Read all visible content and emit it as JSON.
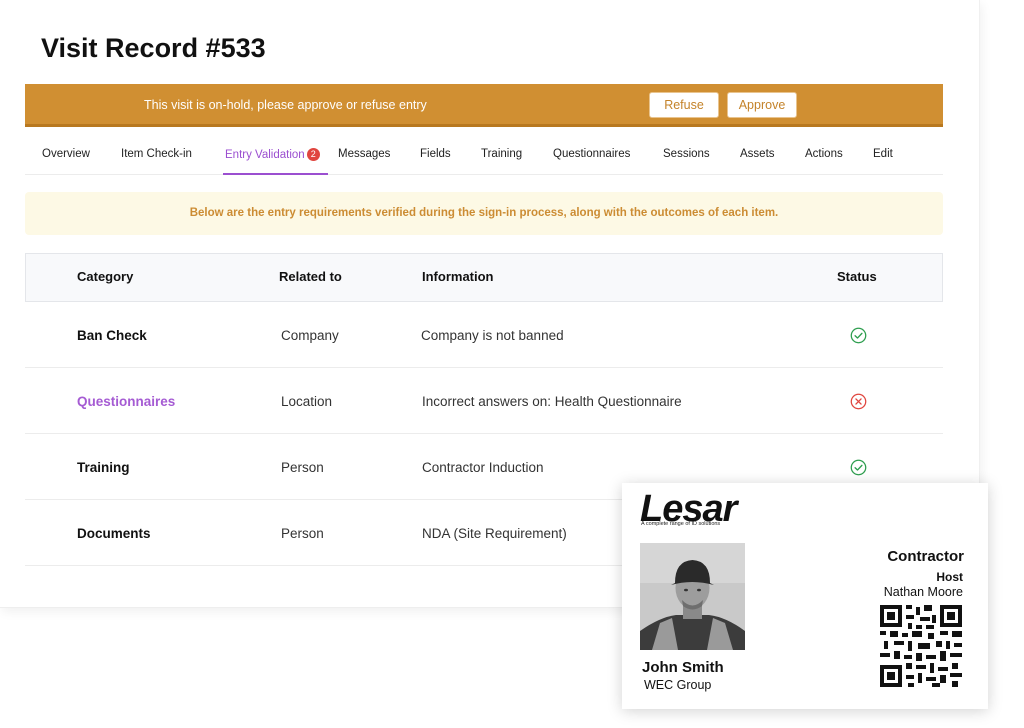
{
  "page": {
    "title": "Visit Record #533"
  },
  "banner": {
    "message": "This visit is on-hold, please approve or refuse entry",
    "refuse_label": "Refuse",
    "approve_label": "Approve",
    "color": "#d08f32"
  },
  "tabs": [
    {
      "label": "Overview"
    },
    {
      "label": "Item Check-in"
    },
    {
      "label": "Entry Validation",
      "badge": "2",
      "active": true
    },
    {
      "label": "Messages"
    },
    {
      "label": "Fields"
    },
    {
      "label": "Training"
    },
    {
      "label": "Questionnaires"
    },
    {
      "label": "Sessions"
    },
    {
      "label": "Assets"
    },
    {
      "label": "Actions"
    },
    {
      "label": "Edit"
    }
  ],
  "note": {
    "text": "Below are the entry requirements verified during the sign-in process, along with the outcomes of each item."
  },
  "table": {
    "headers": {
      "category": "Category",
      "related": "Related to",
      "information": "Information",
      "status": "Status"
    },
    "rows": [
      {
        "category": "Ban Check",
        "related": "Company",
        "information": "Company is not banned",
        "status": "pass-icon"
      },
      {
        "category": "Questionnaires",
        "related": "Location",
        "information": "Incorrect answers on: Health Questionnaire",
        "status": "fail-icon"
      },
      {
        "category": "Training",
        "related": "Person",
        "information": "Contractor Induction",
        "status": "pass-icon"
      },
      {
        "category": "Documents",
        "related": "Person",
        "information": "NDA (Site Requirement)",
        "status": ""
      }
    ],
    "pass_color": "#2e9e4f",
    "fail_color": "#e0463f"
  },
  "badge_card": {
    "logo": "Lesar",
    "logo_tagline": "A complete range of ID solutions",
    "visitor_name": "John Smith",
    "visitor_company": "WEC Group",
    "role": "Contractor",
    "host_label": "Host",
    "host_name": "Nathan Moore",
    "qr_icon": "qr-code-icon"
  },
  "accent_color": "#9b4fd0"
}
